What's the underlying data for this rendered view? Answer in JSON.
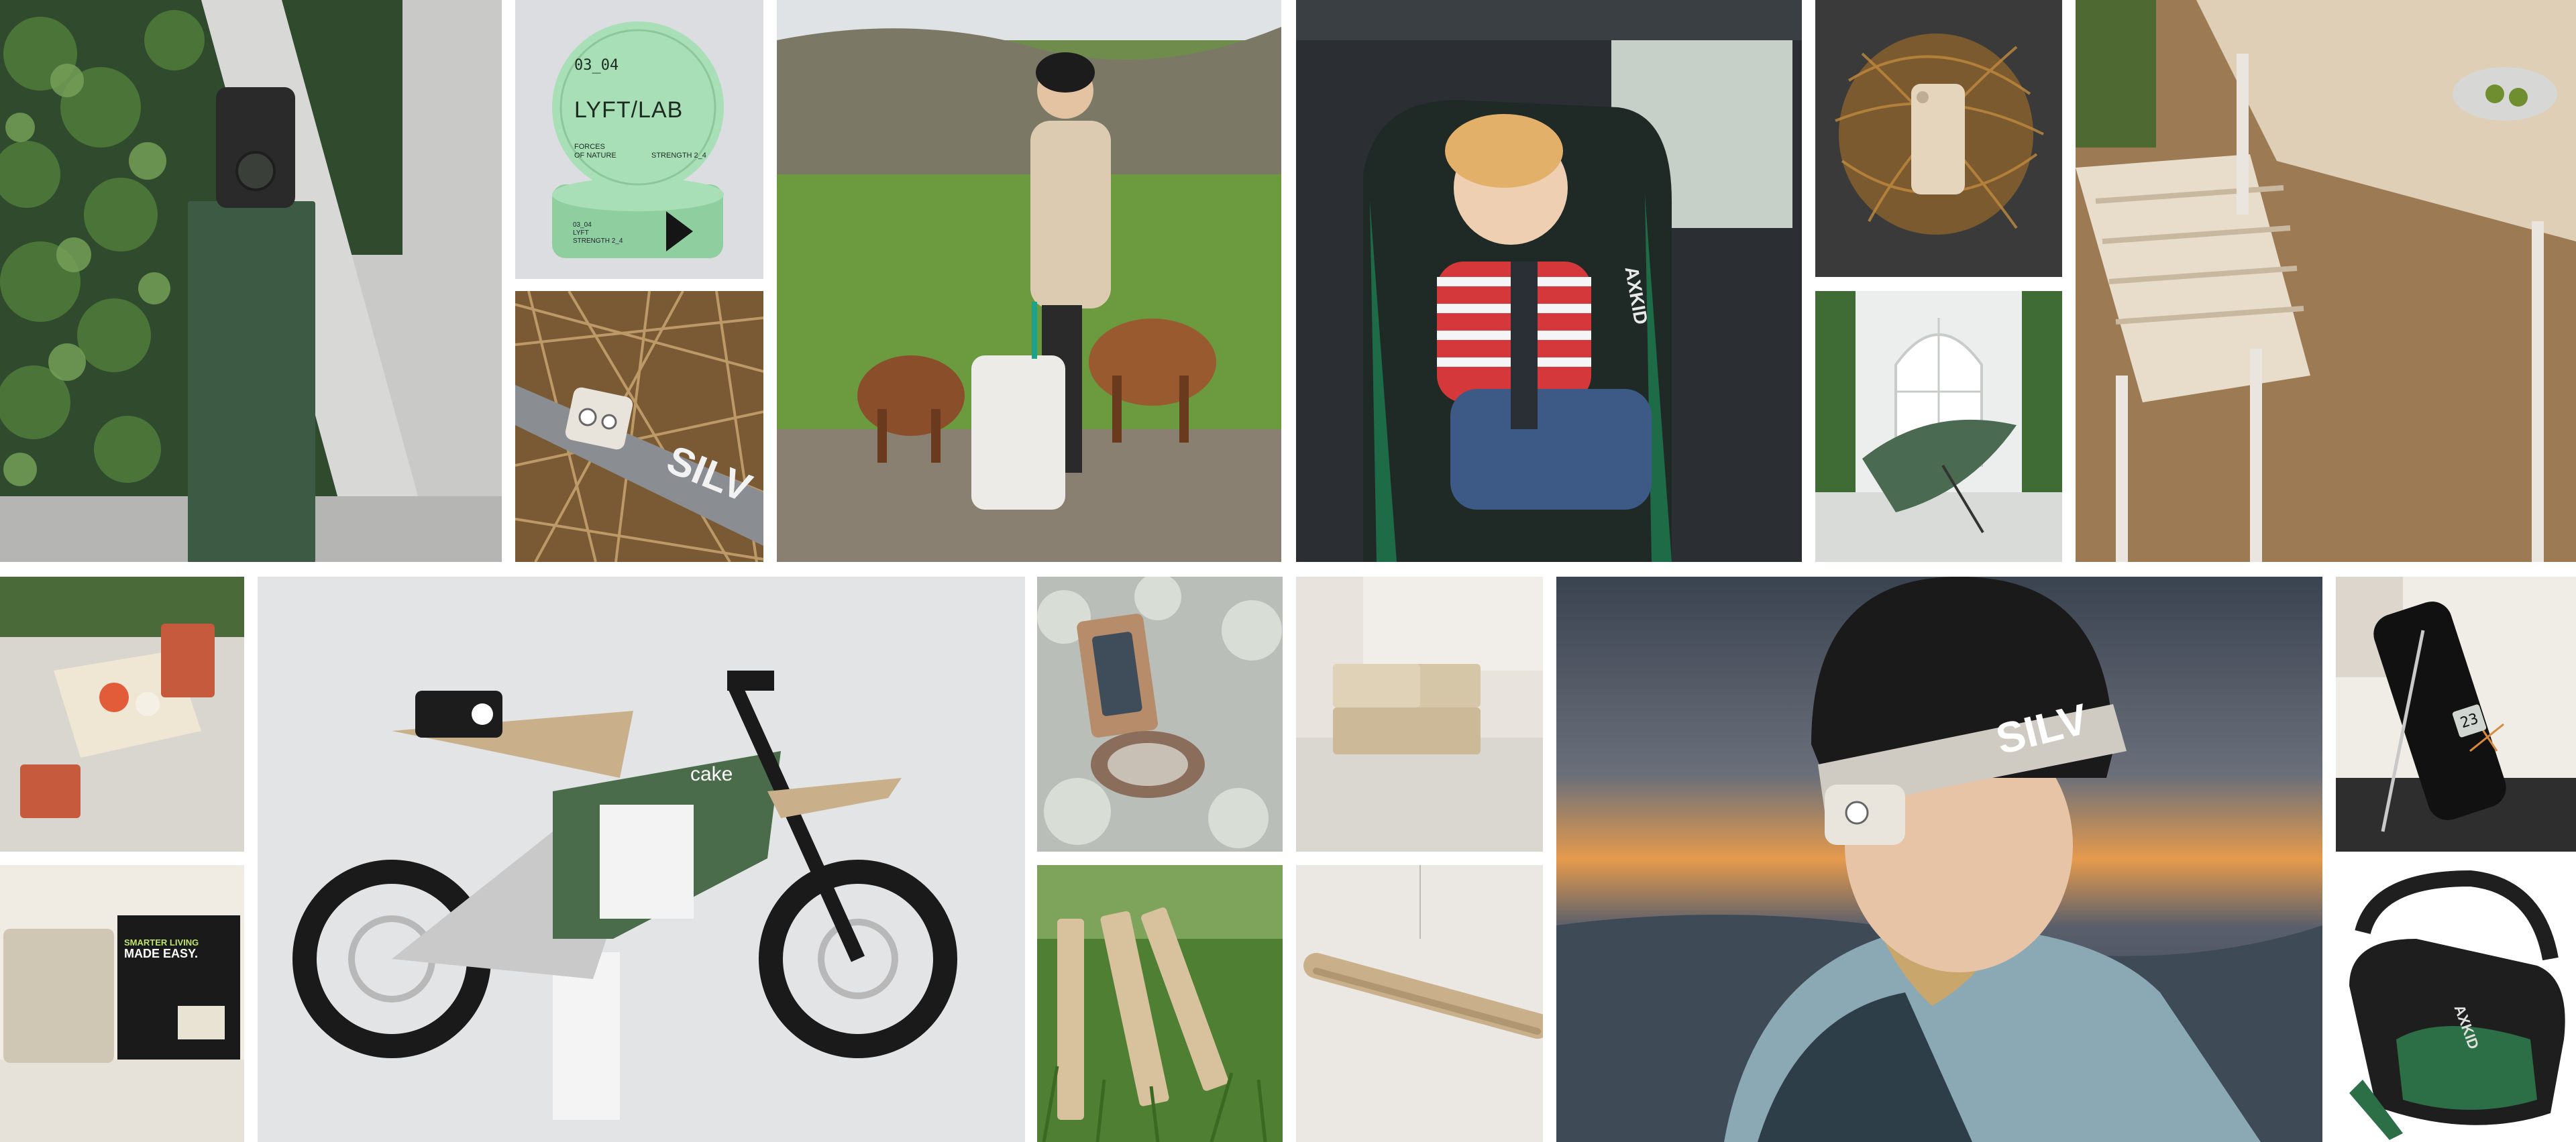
{
  "lyft_lab": {
    "logo": "LYFT/LAB",
    "code": "03_04",
    "line1": "FORCES",
    "line2": "OF NATURE",
    "strength": "STRENGTH 2_4",
    "mini1": "03_04",
    "mini2": "LYFT",
    "mini3": "STRENGTH 2_4"
  },
  "headlamp_band_text": "SILV",
  "ebike_brand": "cake",
  "car_seat_brand": "AXKID",
  "box_text": {
    "line1": "SMARTER LIVING",
    "line2": "MADE EASY."
  },
  "thermometer_reading": "23",
  "colors": {
    "forest_green": "#3c5a44",
    "mint": "#a9dfb7",
    "sand": "#c9b08a",
    "sky_orange": "#e59a4d"
  }
}
